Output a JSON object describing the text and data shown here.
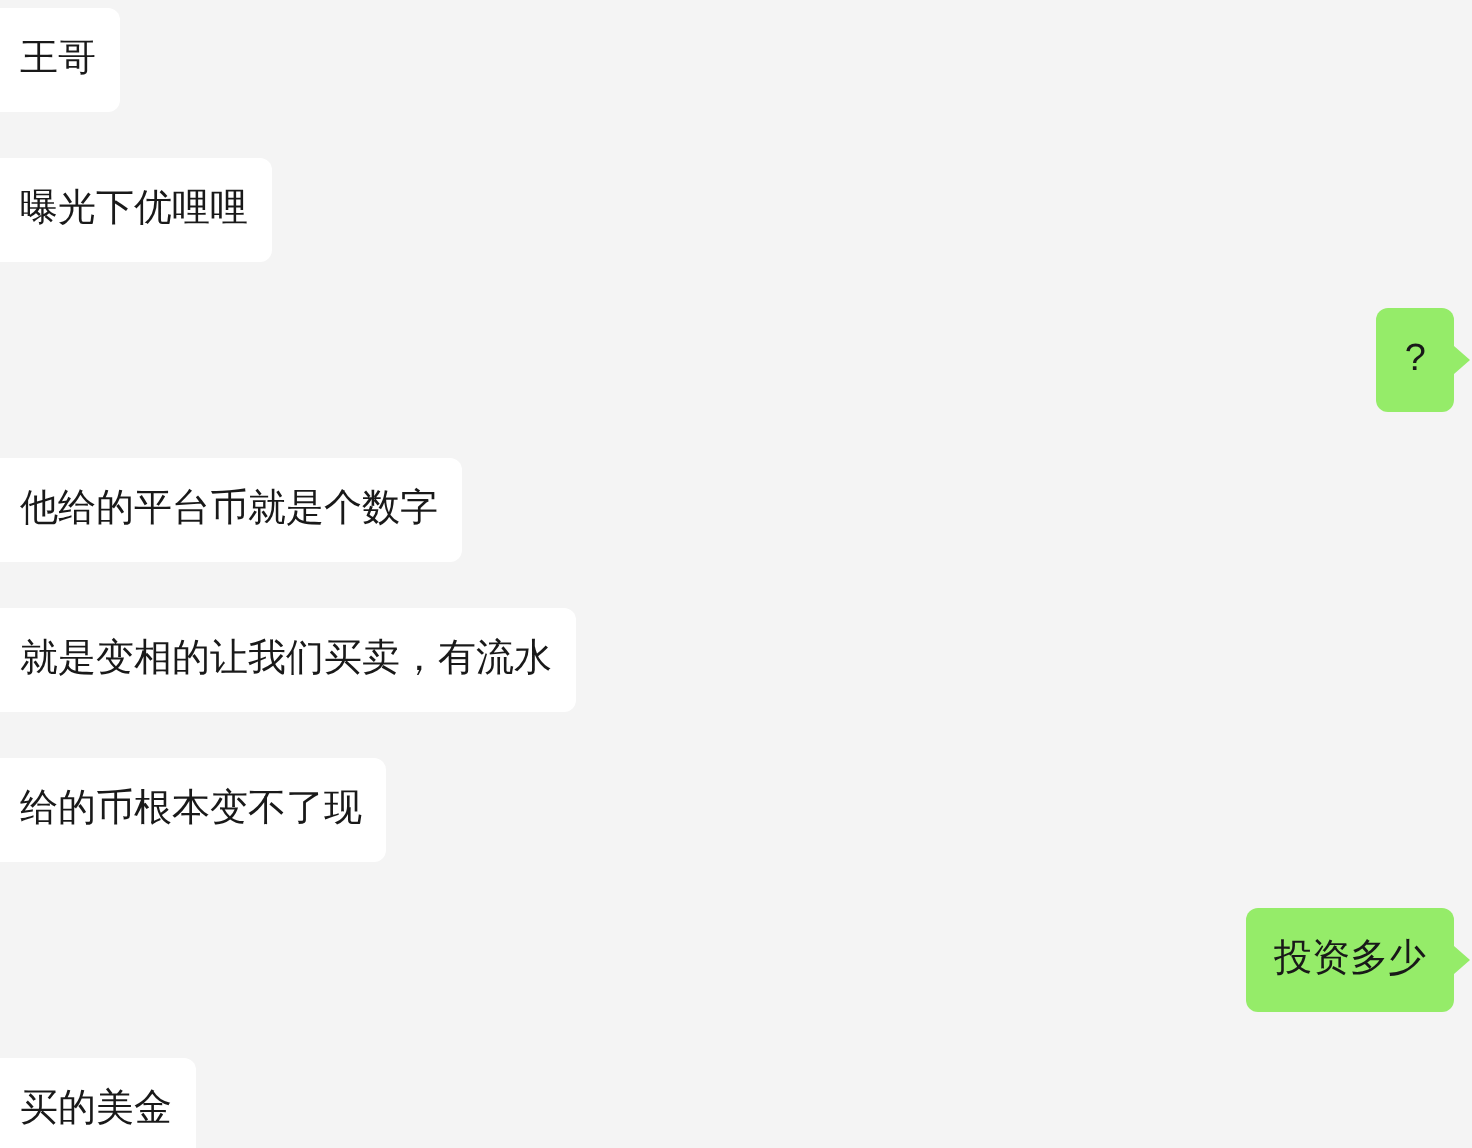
{
  "messages": [
    {
      "kind": "received",
      "text": "王哥"
    },
    {
      "kind": "received",
      "text": "曝光下优哩哩"
    },
    {
      "kind": "sent",
      "text": "?"
    },
    {
      "kind": "received",
      "text": "他给的平台币就是个数字"
    },
    {
      "kind": "received",
      "text": "就是变相的让我们买卖，有流水"
    },
    {
      "kind": "received",
      "text": "给的币根本变不了现"
    },
    {
      "kind": "sent",
      "text": "投资多少"
    },
    {
      "kind": "received",
      "text": "买的美金"
    }
  ]
}
